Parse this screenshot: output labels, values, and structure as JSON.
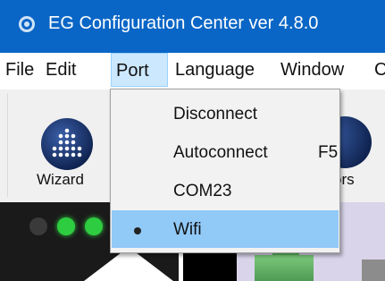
{
  "titlebar": {
    "title": "EG Configuration Center ver 4.8.0",
    "icon": "app-logo-icon"
  },
  "menubar": {
    "items": [
      {
        "label": "File"
      },
      {
        "label": "Edit"
      },
      {
        "label": "Port"
      },
      {
        "label": "Language"
      },
      {
        "label": "Window"
      },
      {
        "label": "C"
      }
    ]
  },
  "toolbar": {
    "wizard_label": "Wizard",
    "sensors_label": "ors"
  },
  "port_menu": {
    "items": [
      {
        "label": "Disconnect",
        "shortcut": ""
      },
      {
        "label": "Autoconnect",
        "shortcut": "F5"
      },
      {
        "label": "COM23",
        "shortcut": ""
      },
      {
        "label": "Wifi",
        "shortcut": "",
        "checked": true
      }
    ]
  },
  "colors": {
    "titlebar": "#0a66c6",
    "menu_highlight": "#cce8ff",
    "selected_item": "#91c9f7",
    "led_green": "#2ecc40"
  }
}
